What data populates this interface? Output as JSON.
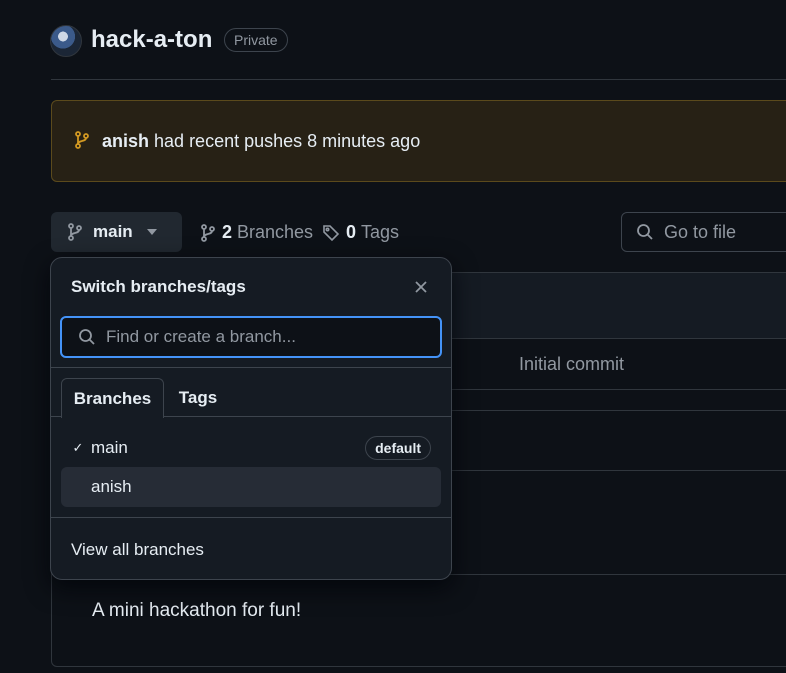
{
  "repo": {
    "name": "hack-a-ton",
    "visibility": "Private"
  },
  "banner": {
    "user": "anish",
    "message": "had recent pushes 8 minutes ago"
  },
  "toolbar": {
    "branch_label": "main",
    "branches_count": "2",
    "branches_label": "Branches",
    "tags_count": "0",
    "tags_label": "Tags",
    "goto_placeholder": "Go to file"
  },
  "file_list": {
    "commit_message": "Initial commit",
    "about": "A mini hackathon for fun!"
  },
  "dropdown": {
    "title": "Switch branches/tags",
    "search_placeholder": "Find or create a branch...",
    "tabs": [
      "Branches",
      "Tags"
    ],
    "branches": [
      {
        "name": "main",
        "badge": "default",
        "checked": true
      },
      {
        "name": "anish",
        "badge": "",
        "checked": false
      }
    ],
    "view_all": "View all branches"
  },
  "colors": {
    "background": "#0d1117",
    "accent": "#4493f8",
    "banner_icon": "#d29922"
  }
}
